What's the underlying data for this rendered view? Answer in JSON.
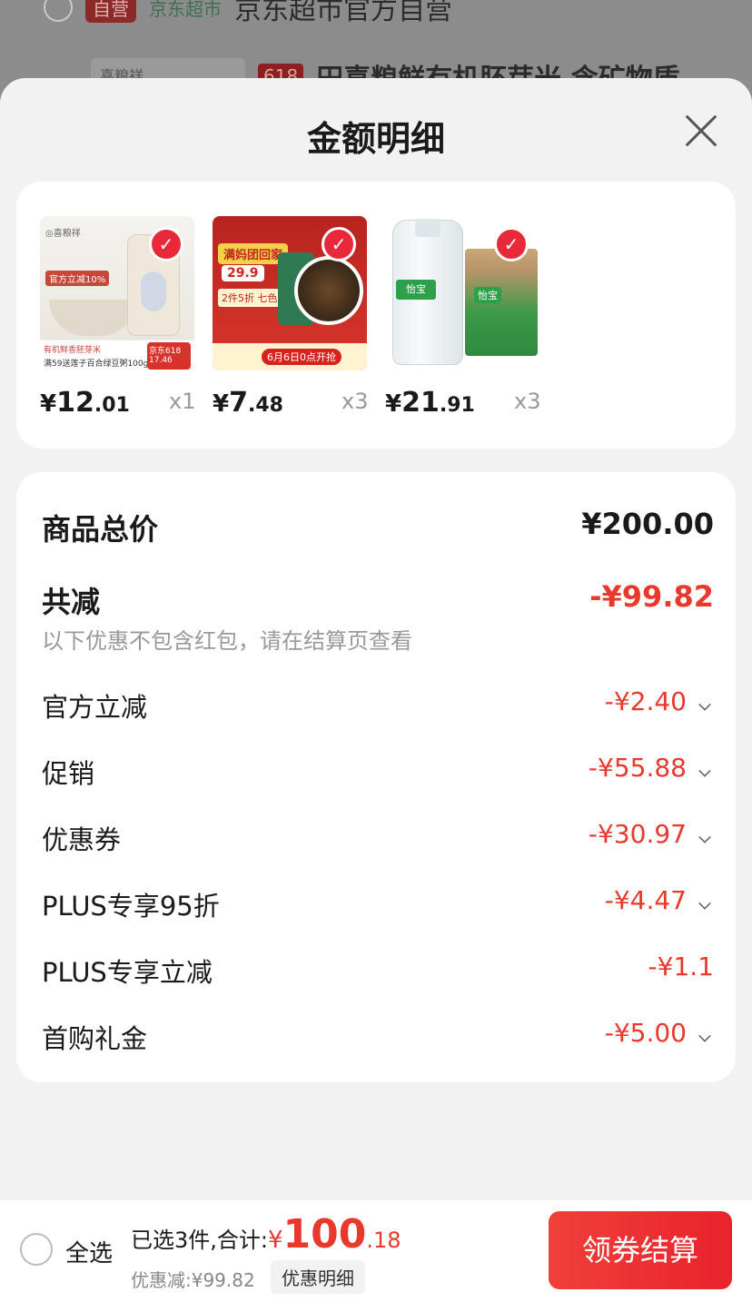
{
  "background": {
    "badge": "自营",
    "store_tag": "京东超市",
    "store_name": "京东超市官方自营",
    "thumb_text": "喜粮祥",
    "promo_618": "618",
    "product_title": "田喜粮鲜有机胚芽米 含矿物质"
  },
  "sheet": {
    "title": "金额明细"
  },
  "products": [
    {
      "yen": "¥",
      "int": "12",
      "dec": ".01",
      "qty": "x1",
      "img_label": "官方立减10%",
      "img_strip1": "有机鲜香胚芽米",
      "img_strip2": "满59送莲子百合绿豆粥100g",
      "img_red": "京东618 17.46"
    },
    {
      "yen": "¥",
      "int": "7",
      "dec": ".48",
      "qty": "x3",
      "img_banner": "满妈团回家",
      "img_price": "29.9",
      "img_tag": "2件5折 七色搭配",
      "img_bottom": "6月6日0点开抢"
    },
    {
      "yen": "¥",
      "int": "21",
      "dec": ".91",
      "qty": "x3",
      "img_label": "怡宝",
      "img_box": "怡宝"
    }
  ],
  "breakdown": {
    "total_label": "商品总价",
    "total_value": "¥200.00",
    "saved_label": "共减",
    "saved_value": "-¥99.82",
    "note": "以下优惠不包含红包，请在结算页查看",
    "rows": [
      {
        "label": "官方立减",
        "value": "-¥2.40"
      },
      {
        "label": "促销",
        "value": "-¥55.88"
      },
      {
        "label": "优惠券",
        "value": "-¥30.97"
      },
      {
        "label": "PLUS专享95折",
        "value": "-¥4.47"
      },
      {
        "label": "PLUS专享立减",
        "value": "-¥1.1"
      },
      {
        "label": "首购礼金",
        "value": "-¥5.00"
      }
    ]
  },
  "bottom": {
    "select_all": "全选",
    "selected_text": "已选3件,合计:",
    "yen": "¥",
    "total_int": "100",
    "total_dec": ".18",
    "discount_text": "优惠减:¥99.82",
    "detail_chip": "优惠明细",
    "checkout": "领券结算"
  },
  "colors": {
    "accent_red": "#e8392c",
    "checkout_red": "#e8232c"
  }
}
